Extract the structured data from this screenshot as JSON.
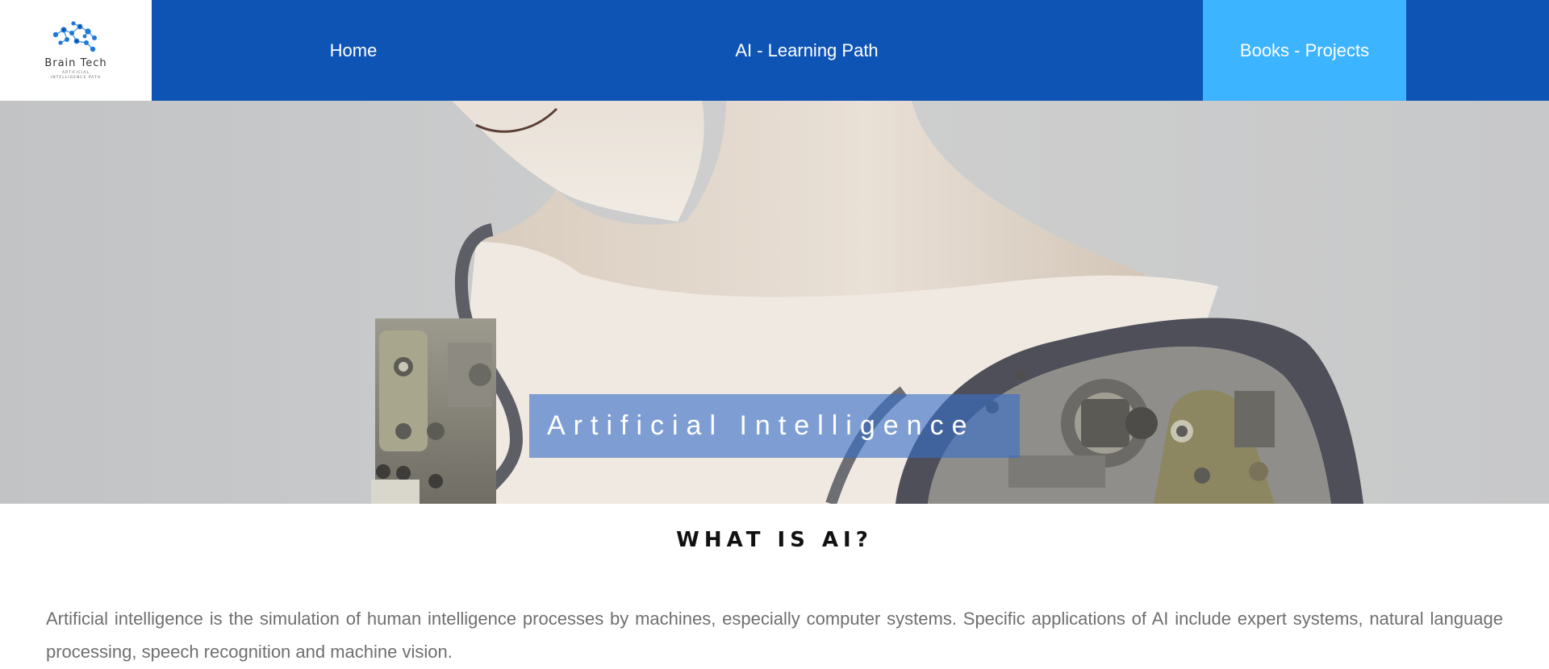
{
  "logo": {
    "name": "Brain Tech",
    "tagline": "Artificial Intelligence Path"
  },
  "nav": {
    "home": "Home",
    "learning_path": "AI - Learning Path",
    "books_projects": "Books - Projects"
  },
  "hero": {
    "title": "Artificial Intelligence"
  },
  "section": {
    "title": "WHAT IS AI?",
    "body": "Artificial intelligence is the simulation of human intelligence processes by machines, especially computer systems. Specific applications of AI include expert systems, natural language processing, speech recognition and machine vision."
  },
  "colors": {
    "nav_bg": "#0e54b5",
    "nav_active": "#3cb4ff",
    "hero_overlay": "#3870ca",
    "text_muted": "#6f6f6f"
  }
}
